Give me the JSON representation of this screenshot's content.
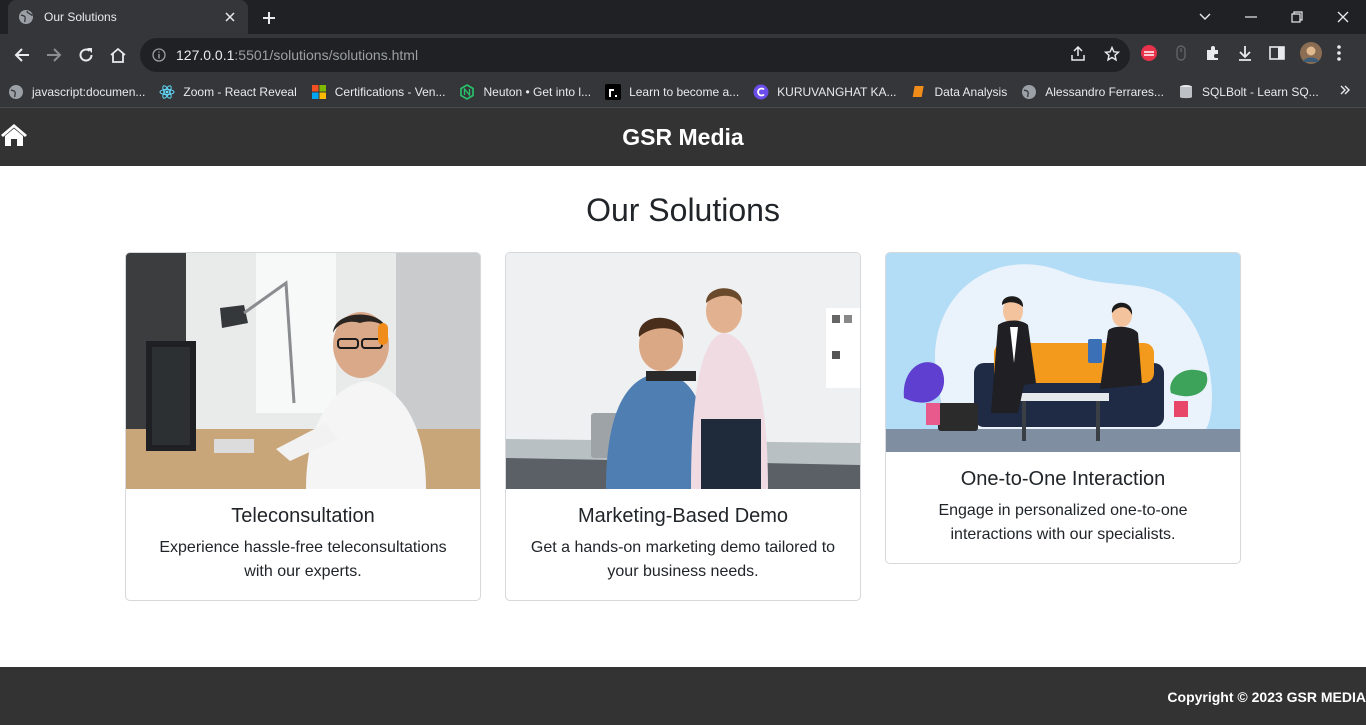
{
  "browser": {
    "tab_title": "Our Solutions",
    "url_host": "127.0.0.1",
    "url_path": ":5501/solutions/solutions.html",
    "bookmarks": [
      {
        "label": "javascript:documen...",
        "icon": "globe-icon"
      },
      {
        "label": "Zoom - React Reveal",
        "icon": "react-icon"
      },
      {
        "label": "Certifications - Ven...",
        "icon": "microsoft-icon"
      },
      {
        "label": "Neuton • Get into l...",
        "icon": "neuton-icon"
      },
      {
        "label": "Learn to become a...",
        "icon": "r-icon"
      },
      {
        "label": "KURUVANGHAT KA...",
        "icon": "c-icon"
      },
      {
        "label": "Data Analysis",
        "icon": "book-icon"
      },
      {
        "label": "Alessandro Ferrares...",
        "icon": "globe-icon"
      },
      {
        "label": "SQLBolt - Learn SQ...",
        "icon": "database-icon"
      }
    ]
  },
  "site": {
    "brand": "GSR Media",
    "page_title": "Our Solutions",
    "cards": [
      {
        "title": "Teleconsultation",
        "text": "Experience hassle-free teleconsultations with our experts."
      },
      {
        "title": "Marketing-Based Demo",
        "text": "Get a hands-on marketing demo tailored to your business needs."
      },
      {
        "title": "One-to-One Interaction",
        "text": "Engage in personalized one-to-one interactions with our specialists."
      }
    ],
    "footer": "Copyright © 2023 GSR MEDIA"
  },
  "colors": {
    "header_bg": "#333333",
    "card_border": "#d6d8db"
  }
}
